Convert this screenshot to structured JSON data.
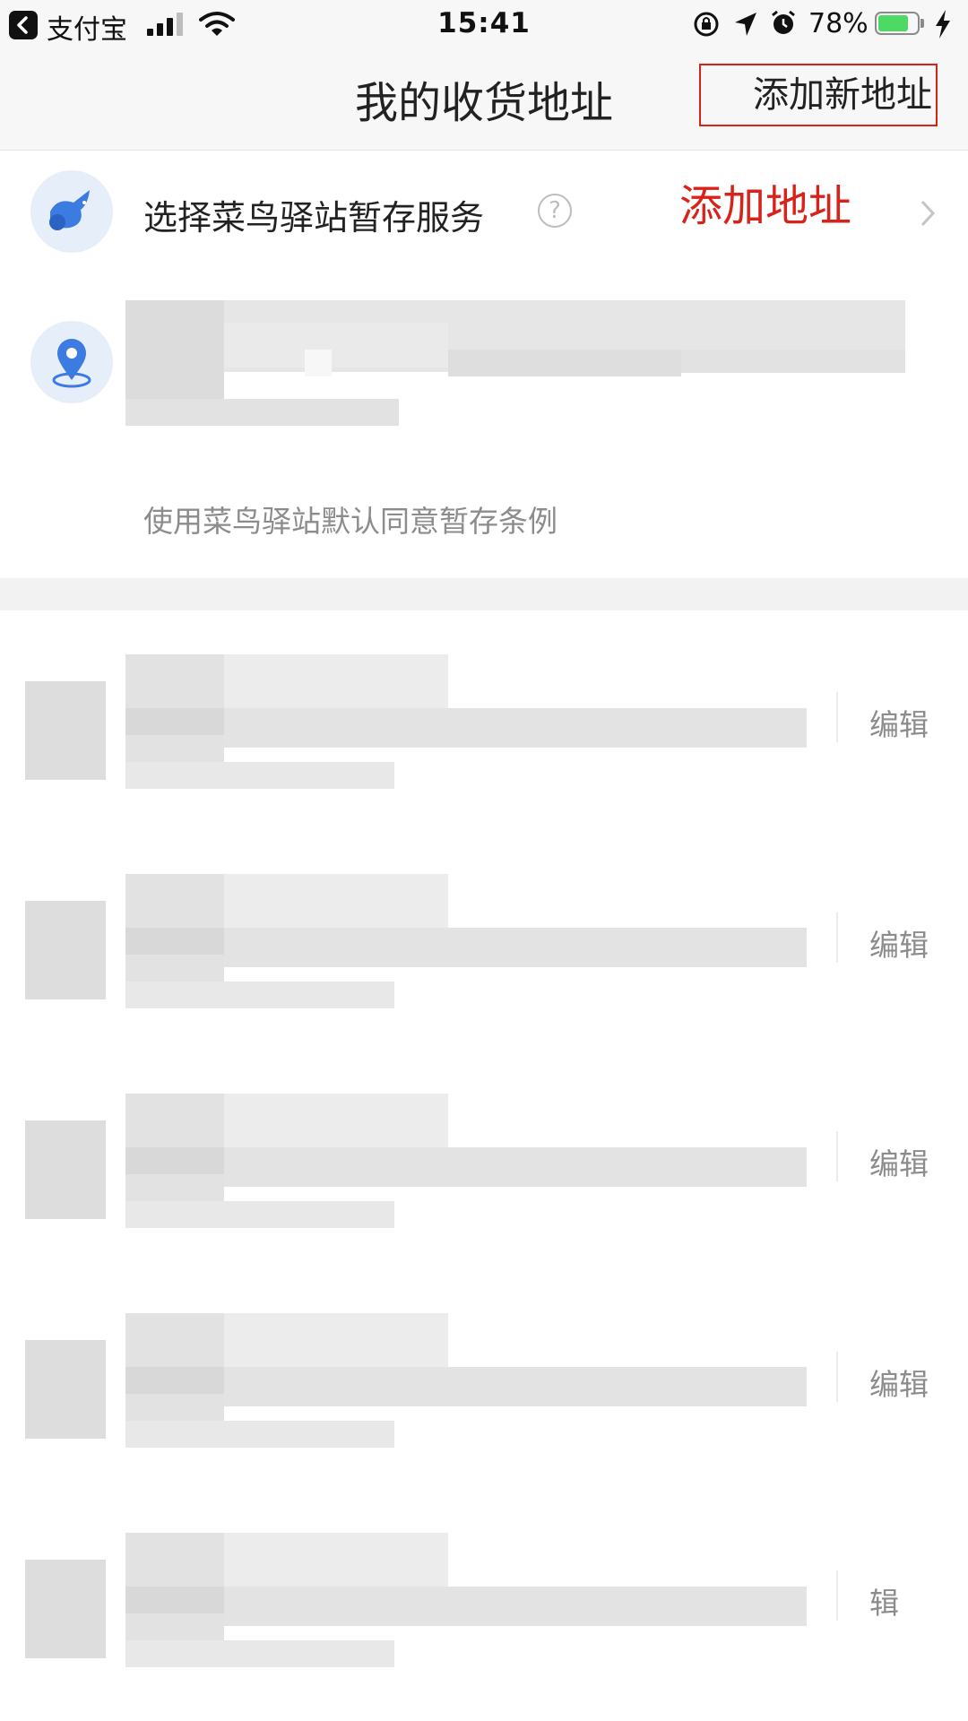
{
  "status_bar": {
    "back_app": "支付宝",
    "time": "15:41",
    "battery_text": "78%",
    "battery_level": 0.78,
    "battery_color": "#4cd964"
  },
  "nav": {
    "title": "我的收货地址",
    "add_button": "添加新地址",
    "highlight_color": "#d8231b"
  },
  "cainiao": {
    "label": "选择菜鸟驿站暂存服务",
    "help_icon": "question-circle-icon",
    "help_glyph": "?",
    "annotation": "添加地址",
    "terms": "使用菜鸟驿站默认同意暂存条例",
    "icon_color": "#3c7be0"
  },
  "addresses": [
    {
      "edit_label": "编辑"
    },
    {
      "edit_label": "编辑"
    },
    {
      "edit_label": "编辑"
    },
    {
      "edit_label": "编辑"
    },
    {
      "edit_label": "辑"
    }
  ]
}
